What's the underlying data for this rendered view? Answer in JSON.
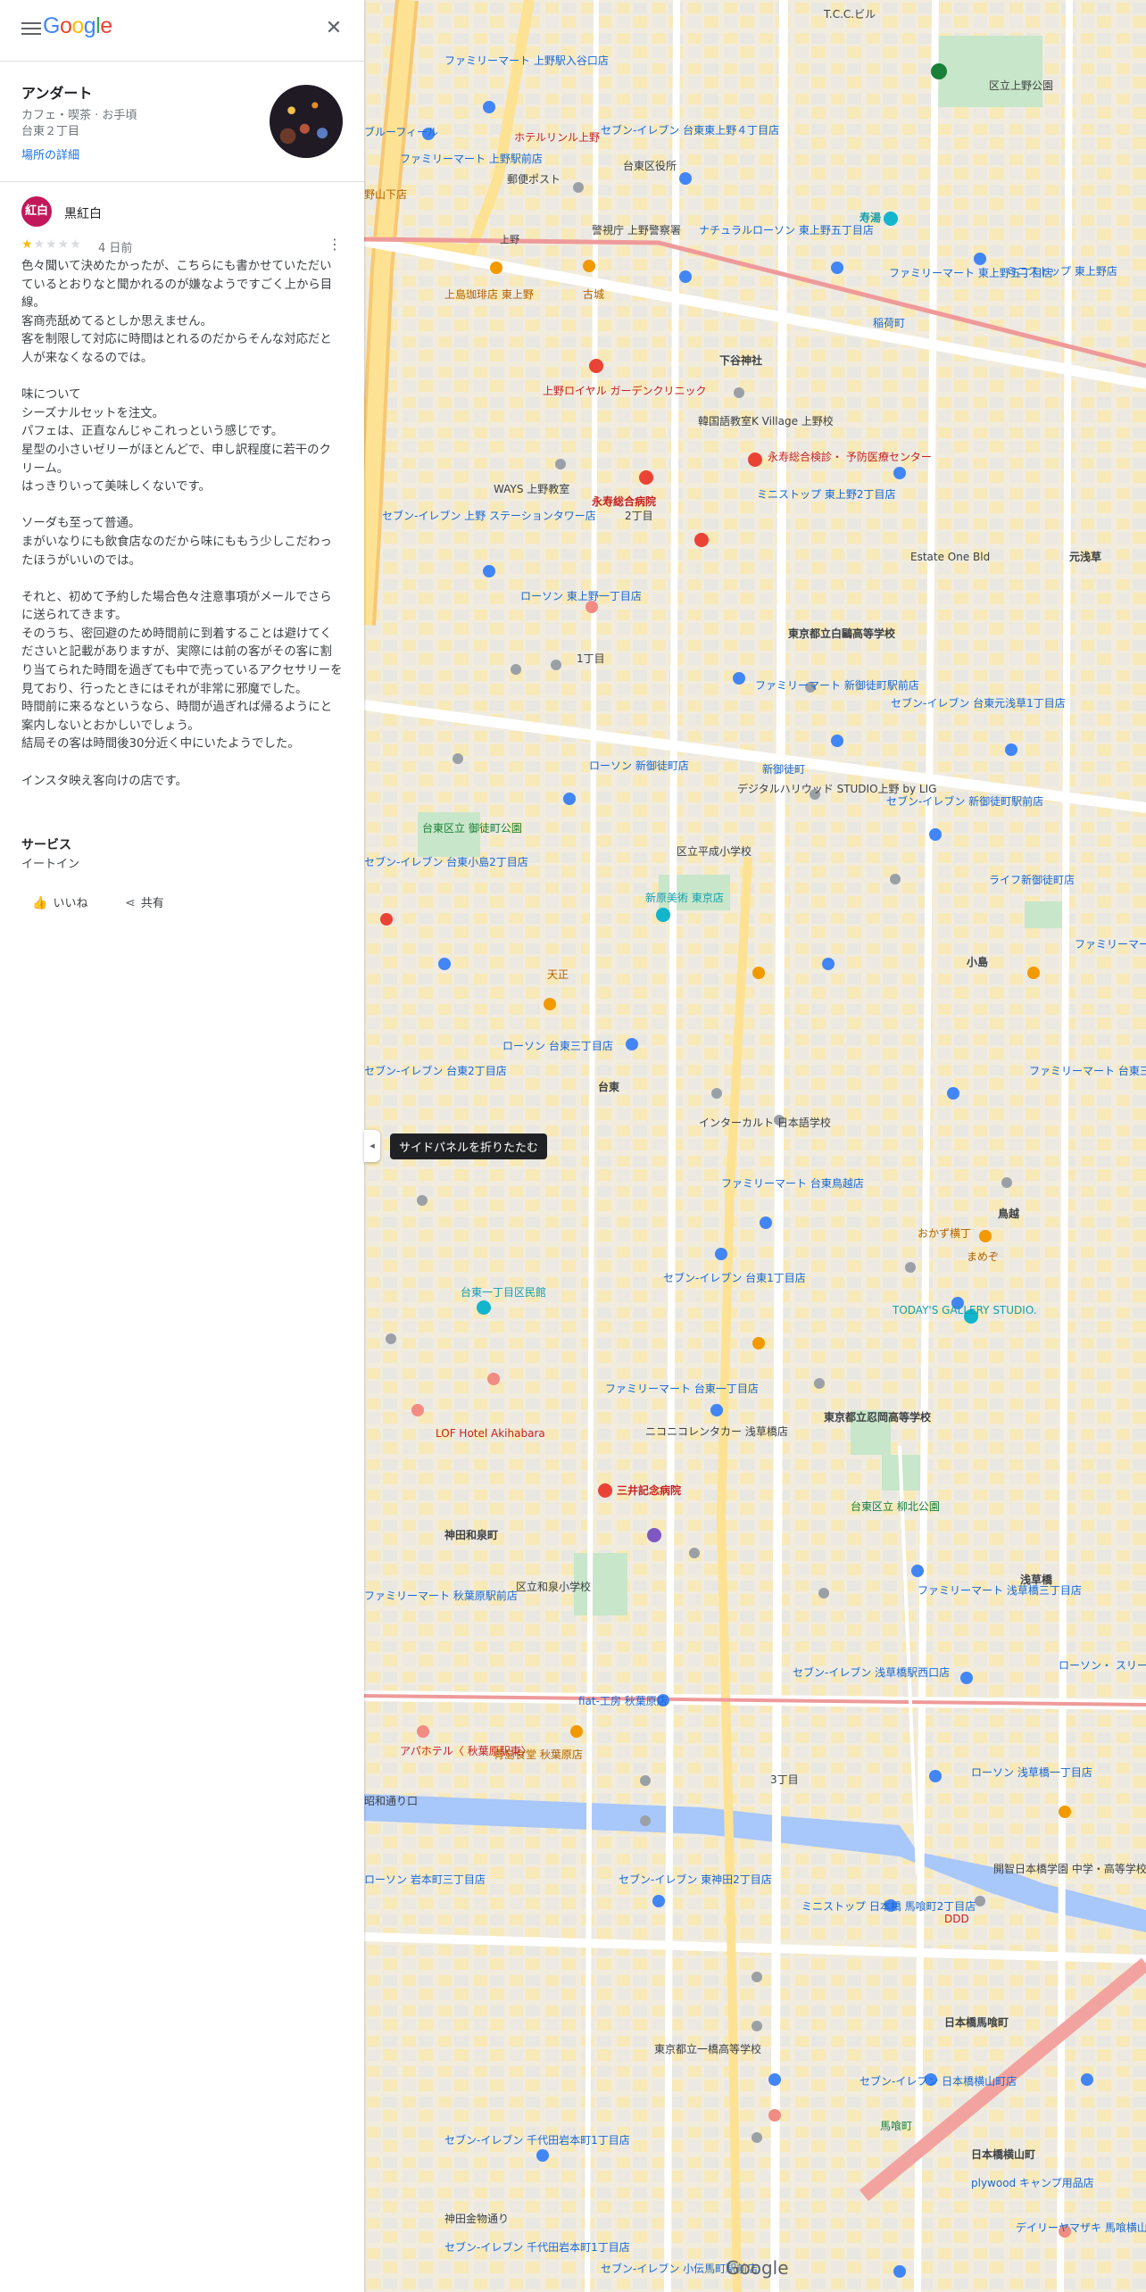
{
  "header": {
    "logo": "Google",
    "menu_icon": "hamburger-icon",
    "close_icon": "close-icon"
  },
  "place": {
    "name": "アンダート",
    "category": "カフェ・喫茶 · お手頃",
    "area": "台東２丁目",
    "details_link": "場所の詳細"
  },
  "review": {
    "avatar_text": "紅白",
    "author": "黒紅白",
    "rating": 1,
    "date": "4 日前",
    "text": "色々聞いて決めたかったが、こちらにも書かせていただいているとおりなと聞かれるのが嫌なようですごく上から目線。\n客商売舐めてるとしか思えません。\n客を制限して対応に時間はとれるのだからそんな対応だと人が来なくなるのでは。\n\n味について\nシーズナルセットを注文。\nパフェは、正直なんじゃこれっという感じです。\n星型の小さいゼリーがほとんどで、申し訳程度に若干のクリーム。\nはっきりいって美味しくないです。\n\nソーダも至って普通。\nまがいなりにも飲食店なのだから味にももう少しこだわったほうがいいのでは。\n\nそれと、初めて予約した場合色々注意事項がメールでさらに送られてきます。\nそのうち、密回避のため時間前に到着することは避けてくださいと記載がありますが、実際には前の客がその客に割り当てられた時間を過ぎても中で売っているアクセサリーを見ており、行ったときにはそれが非常に邪魔でした。\n時間前に来るなというなら、時間が過ぎれば帰るようにと案内しないとおかしいでしょう。\n結局その客は時間後30分近く中にいたようでした。\n\nインスタ映え客向けの店です。",
    "service_title": "サービス",
    "service_value": "イートイン",
    "like_label": "いいね",
    "share_label": "共有"
  },
  "map": {
    "collapse_tooltip": "サイドパネルを折りたたむ",
    "attribution": "Google",
    "labels": {
      "ueno4": "上野駅入谷口",
      "tct": "T.C.C.ビル",
      "ueno4b": "ファミリーマート 上野駅入谷口店",
      "hotel": "ホテルリンル上野",
      "park": "区立上野公園",
      "blue": "ブルーフィール",
      "fm_ueno": "ファミリーマート 上野駅前店",
      "yamashita": "野山下店",
      "seven_ueno": "セブン-イレブン 台東東上野４丁目店",
      "post": "郵便ポスト",
      "taitou_office": "台東区役所",
      "police": "警視庁 上野警察署",
      "natural": "ナチュラルローソン 東上野五丁目店",
      "kotobuki": "寿湯",
      "fm_higashi": "ファミリーマート 東上野五丁目店",
      "ministop": "ミニストップ 東上野店",
      "ueno_label": "上野",
      "coffee": "上島珈琲店 東上野",
      "kojou": "古城",
      "inaricho": "稲荷町",
      "shitaya": "下谷神社",
      "royal": "上野ロイヤル ガーデンクリニック",
      "kankoku": "韓国語教室K Village 上野校",
      "eiju_center": "永寿総合検診・ 予防医療センター",
      "ways": "WAYS 上野教室",
      "eiju": "永寿総合病院",
      "chome2": "2丁目",
      "ministop2": "ミニストップ 東上野2丁目店",
      "seven_ueno2": "セブン-イレブン 上野 ステーションタワー店",
      "estate": "Estate One Bld",
      "motoasakusa": "元浅草",
      "lawson_ueno": "ローソン 東上野一丁目店",
      "hakuo": "東京都立白鷗高等学校",
      "chome1": "1丁目",
      "fm_shinokachi": "ファミリーマート 新御徒町駅前店",
      "seven_asakusa": "セブン-イレブン 台東元浅草1丁目店",
      "lawson_shinokachi": "ローソン 新御徒町店",
      "shinokachimachi": "新御徒町",
      "dh": "デジタルハリウッド STUDIO上野 by LIG",
      "seven_shinokachi": "セブン-イレブン 新御徒町駅前店",
      "heisei_school": "区立平成小学校",
      "okachimachi_park": "台東区立 御徒町公園",
      "seven_kojima": "セブン-イレブン 台東小島2丁目店",
      "life": "ライフ新御徒町店",
      "shinkuro": "新原美術 東京店",
      "kojima": "小島",
      "tenmasa": "天正",
      "fm_sanchome": "ファミリーマート 台東三丁目店",
      "lawson_taito3": "ローソン 台東三丁目店",
      "seven_taito2": "セブン-イレブン 台東2丁目店",
      "fm_mitsuji": "ファミリーマート 台東三筋一丁目店",
      "taito": "台東",
      "interculture": "インターカルト 日本語学校",
      "fm_torikoe": "ファミリーマート 台東鳥越店",
      "torikoe": "鳥越",
      "okazu": "おかず横丁",
      "mamegoto": "まめぞ",
      "seven_taito1": "セブン-イレブン 台東1丁目店",
      "minka": "台東一丁目区民館",
      "todays": "TODAY'S GALLERY STUDIO.",
      "chuuritsu": "東京都立忍岡高等学校",
      "lof": "LOF Hotel Akihabara",
      "fm_taito1": "ファミリーマート 台東一丁目店",
      "nico": "ニコニコレンタカー 浅草橋店",
      "mitsui": "三井記念病院",
      "izumi": "神田和泉町",
      "yanagibashi": "台東区立 柳北公園",
      "izumi_school": "区立和泉小学校",
      "fm_asakusabashi": "ファミリーマート 浅草橋三丁目店",
      "asakusabashi": "浅草橋",
      "lawson_asakusabashi": "ローソン・ スリーエフ浅草橋店",
      "fm_akiba": "ファミリーマート 秋葉原駅前店",
      "fiat": "fiat-工房 秋葉原店",
      "seven_asakusabashi": "セブン-イレブン 浅草橋駅西口店",
      "aoshima": "青島食堂 秋葉原店",
      "apa": "アパホテル〈 秋葉原駅東〉",
      "showa": "昭和通り口",
      "lawson_asakusabashi1": "ローソン 浅草橋一丁目店",
      "chome3": "3丁目",
      "lawson_iwamoto": "ローソン 岩本町三丁目店",
      "seven_higashikanda": "セブン-イレブン 東神田2丁目店",
      "ministop_nihonbashi": "ミニストップ 日本橋 馬喰町2丁目店",
      "ddd": "DDD",
      "nihonbashi": "日本橋馬喰町",
      "seven_yokoyama": "セブン-イレブン 日本橋横山町店",
      "seven_iwamoto": "セブン-イレブン 千代田岩本町1丁目店",
      "bakurocho": "馬喰町",
      "yokoyama": "日本橋横山町",
      "daily": "デイリーヤマザキ 馬喰横山駅前店",
      "plywood": "plywood キャンプ用品店",
      "seven_kodenmacho": "セブン-イレブン 小伝馬町駅前店",
      "seven_kodenma2": "セブン-イレブン 千代田岩本町1丁目店",
      "highschool_ryogoku": "開智日本橋学園 中学・高等学校",
      "ichiryo": "東京都立一橋高等学校",
      "kanda_kinbo": "神田金物通り"
    }
  }
}
